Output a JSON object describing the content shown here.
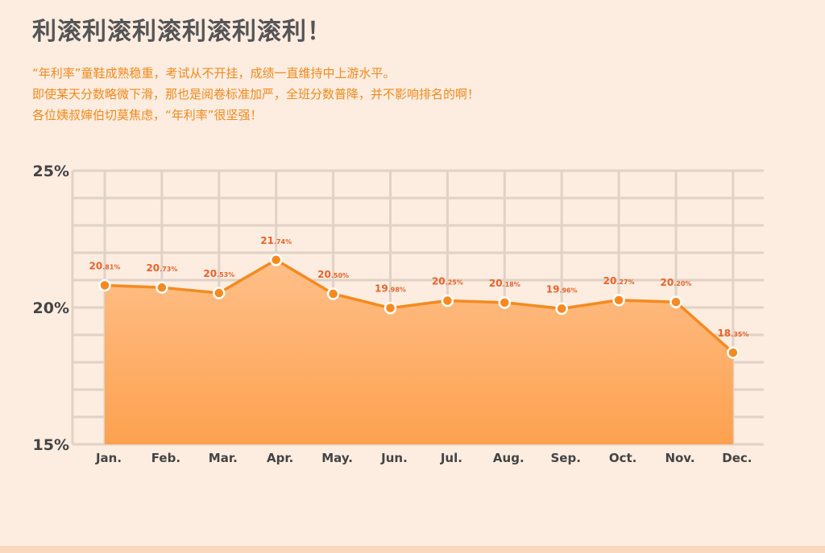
{
  "header": {
    "title": "利滚利滚利滚利滚利滚利！",
    "lines": [
      "“年利率”童鞋成熟稳重，考试从不开挂，成绩一直维持中上游水平。",
      "即使某天分数略微下滑，那也是阅卷标准加严，全班分数普降，并不影响排名的啊！",
      "各位姨叔婶伯切莫焦虑，“年利率”很坚强！"
    ]
  },
  "colors": {
    "accent": "#f58a1f",
    "area_top": "#ffbf88",
    "area_bottom": "#fda150",
    "grid": "#e0d2c6",
    "label": "#e8632a",
    "axis_text": "#444444"
  },
  "chart_data": {
    "type": "area",
    "title": "",
    "xlabel": "",
    "ylabel": "",
    "ylim": [
      15,
      25
    ],
    "yticks": [
      "15%",
      "20%",
      "25%"
    ],
    "ytick_values": [
      15,
      20,
      25
    ],
    "grid": true,
    "categories": [
      "Jan.",
      "Feb.",
      "Mar.",
      "Apr.",
      "May.",
      "Jun.",
      "Jul.",
      "Aug.",
      "Sep.",
      "Oct.",
      "Nov.",
      "Dec."
    ],
    "values": [
      20.81,
      20.73,
      20.53,
      21.74,
      20.5,
      19.98,
      20.25,
      20.18,
      19.96,
      20.27,
      20.2,
      18.35
    ],
    "label_int": [
      "20",
      "20",
      "20",
      "21",
      "20",
      "19",
      "20",
      "20",
      "19",
      "20",
      "20",
      "18"
    ],
    "label_dec": [
      ".81%",
      ".73%",
      ".53%",
      ".74%",
      ".50%",
      ".98%",
      ".25%",
      ".18%",
      ".96%",
      ".27%",
      ".20%",
      ".35%"
    ]
  }
}
